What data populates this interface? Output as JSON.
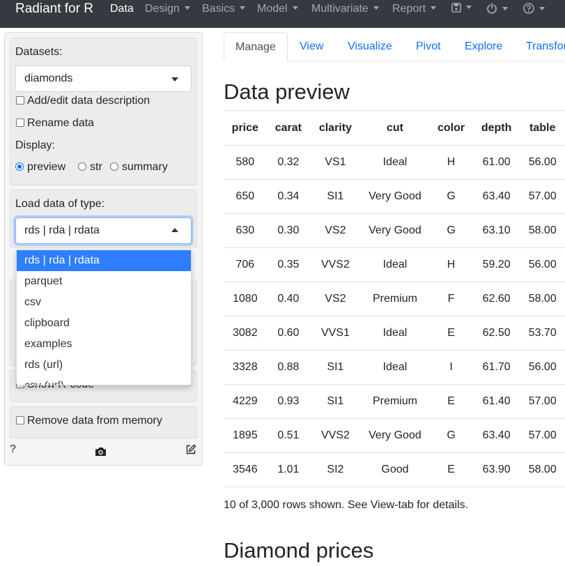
{
  "navbar": {
    "brand": "Radiant for R",
    "items": [
      {
        "label": "Data",
        "active": true
      },
      {
        "label": "Design"
      },
      {
        "label": "Basics"
      },
      {
        "label": "Model"
      },
      {
        "label": "Multivariate"
      },
      {
        "label": "Report"
      }
    ],
    "icons": [
      "save-icon",
      "power-icon",
      "help-circle-icon"
    ]
  },
  "sidebar": {
    "datasets_label": "Datasets:",
    "dataset_value": "diamonds",
    "add_edit_label": "Add/edit data description",
    "rename_label": "Rename data",
    "display_label": "Display:",
    "display_options": [
      "preview",
      "str",
      "summary"
    ],
    "display_selected": "preview",
    "load_label": "Load data of type:",
    "load_value": "rds | rda | rdata",
    "load_options": [
      "rds | rda | rdata",
      "parquet",
      "csv",
      "clipboard",
      "examples",
      "rds (url)",
      "csv (url)"
    ],
    "hidden_checkbox_label": "Show R-code",
    "remove_label": "Remove data from memory",
    "help_label": "?"
  },
  "main": {
    "tabs": [
      "Manage",
      "View",
      "Visualize",
      "Pivot",
      "Explore",
      "Transform"
    ],
    "active_tab": "Manage",
    "preview_title": "Data preview",
    "columns": [
      "price",
      "carat",
      "clarity",
      "cut",
      "color",
      "depth",
      "table"
    ],
    "rows": [
      [
        "580",
        "0.32",
        "VS1",
        "Ideal",
        "H",
        "61.00",
        "56.00"
      ],
      [
        "650",
        "0.34",
        "SI1",
        "Very Good",
        "G",
        "63.40",
        "57.00"
      ],
      [
        "630",
        "0.30",
        "VS2",
        "Very Good",
        "G",
        "63.10",
        "58.00"
      ],
      [
        "706",
        "0.35",
        "VVS2",
        "Ideal",
        "H",
        "59.20",
        "56.00"
      ],
      [
        "1080",
        "0.40",
        "VS2",
        "Premium",
        "F",
        "62.60",
        "58.00"
      ],
      [
        "3082",
        "0.60",
        "VVS1",
        "Ideal",
        "E",
        "62.50",
        "53.70"
      ],
      [
        "3328",
        "0.88",
        "SI1",
        "Ideal",
        "I",
        "61.70",
        "56.00"
      ],
      [
        "4229",
        "0.93",
        "SI1",
        "Premium",
        "E",
        "61.40",
        "57.00"
      ],
      [
        "1895",
        "0.51",
        "VVS2",
        "Very Good",
        "G",
        "63.40",
        "57.00"
      ],
      [
        "3546",
        "1.01",
        "SI2",
        "Good",
        "E",
        "63.90",
        "58.00"
      ]
    ],
    "rows_note": "10 of 3,000 rows shown. See View-tab for details.",
    "section_title": "Diamond prices"
  },
  "colors": {
    "navbar_bg": "#343a40",
    "accent": "#0d6efd",
    "menu_selected": "#2d7fff"
  }
}
